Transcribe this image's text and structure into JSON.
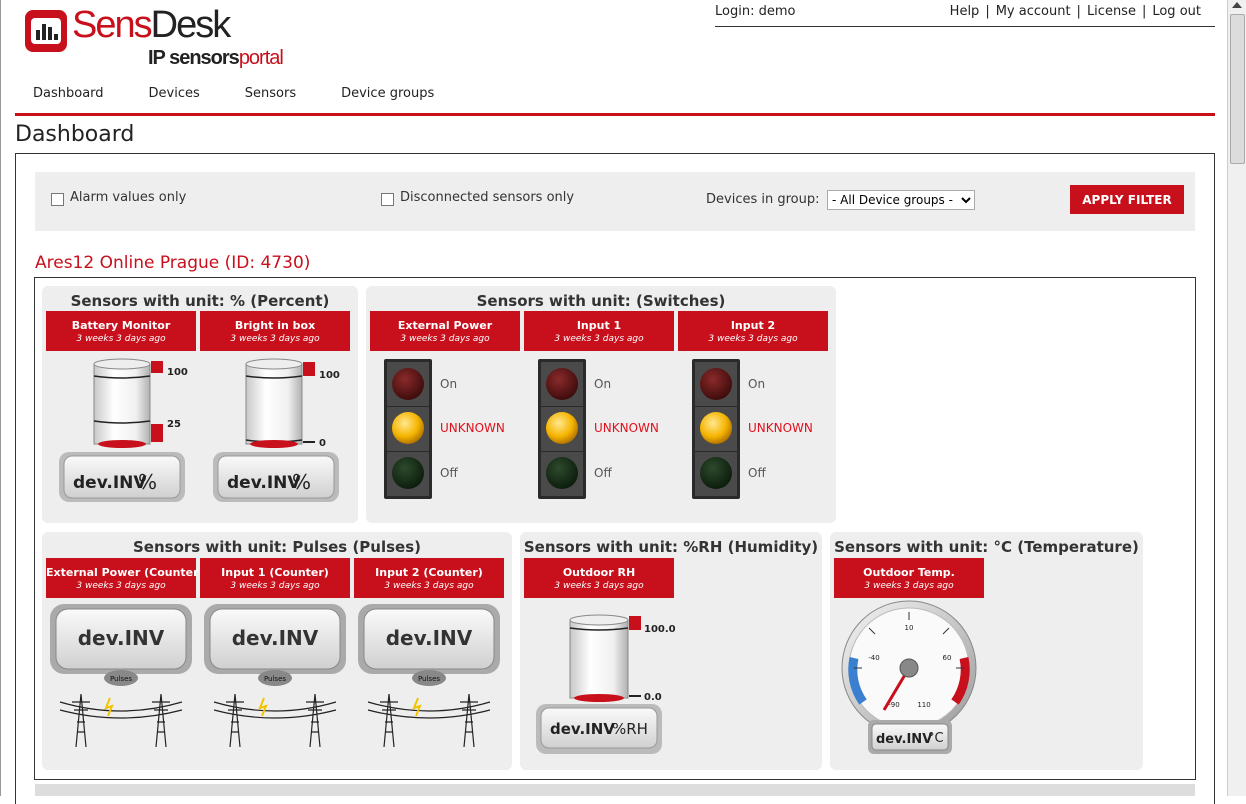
{
  "logo": {
    "sens": "Sens",
    "desk": "Desk",
    "sub_ip": "IP sensors",
    "sub_portal": "portal"
  },
  "topbar": {
    "login": "Login: demo",
    "links": [
      "Help",
      "My account",
      "License",
      "Log out"
    ]
  },
  "nav": [
    "Dashboard",
    "Devices",
    "Sensors",
    "Device groups"
  ],
  "page_title": "Dashboard",
  "filter": {
    "alarm_label": "Alarm values only",
    "disconnected_label": "Disconnected sensors only",
    "group_label": "Devices in group:",
    "group_value": "- All Device groups -",
    "apply_label": "APPLY FILTER"
  },
  "device": {
    "title": "Ares12 Online Prague (ID: 4730)",
    "groups": [
      {
        "title": "Sensors with unit: % (Percent)",
        "sensors": [
          {
            "name": "Battery Monitor",
            "time": "3 weeks 3 days ago",
            "max": "100",
            "alarm": "25",
            "value": "dev.INV",
            "unit": "%"
          },
          {
            "name": "Bright in box",
            "time": "3 weeks 3 days ago",
            "max": "100",
            "min": "0",
            "value": "dev.INV",
            "unit": "%"
          }
        ]
      },
      {
        "title": "Sensors with unit: (Switches)",
        "sensors": [
          {
            "name": "External Power",
            "time": "3 weeks 3 days ago",
            "on": "On",
            "state": "UNKNOWN",
            "off": "Off"
          },
          {
            "name": "Input 1",
            "time": "3 weeks 3 days ago",
            "on": "On",
            "state": "UNKNOWN",
            "off": "Off"
          },
          {
            "name": "Input 2",
            "time": "3 weeks 3 days ago",
            "on": "On",
            "state": "UNKNOWN",
            "off": "Off"
          }
        ]
      },
      {
        "title": "Sensors with unit: Pulses (Pulses)",
        "sensors": [
          {
            "name": "External Power (Counter)",
            "time": "3 weeks 3 days ago",
            "value": "dev.INV",
            "unit": "Pulses"
          },
          {
            "name": "Input 1 (Counter)",
            "time": "3 weeks 3 days ago",
            "value": "dev.INV",
            "unit": "Pulses"
          },
          {
            "name": "Input 2 (Counter)",
            "time": "3 weeks 3 days ago",
            "value": "dev.INV",
            "unit": "Pulses"
          }
        ]
      },
      {
        "title": "Sensors with unit: %RH (Humidity)",
        "sensors": [
          {
            "name": "Outdoor RH",
            "time": "3 weeks 3 days ago",
            "max": "100.0",
            "min": "0.0",
            "value": "dev.INV",
            "unit": "%RH"
          }
        ]
      },
      {
        "title": "Sensors with unit: °C (Temperature)",
        "sensors": [
          {
            "name": "Outdoor Temp.",
            "time": "3 weeks 3 days ago",
            "value": "dev.INV",
            "unit": "°C",
            "ticks": [
              "10",
              "-40",
              "60",
              "-90",
              "110"
            ]
          }
        ]
      }
    ]
  },
  "colors": {
    "brand": "#c8101c",
    "panel": "#eeeeee",
    "unknown_text": "#e0101c"
  }
}
